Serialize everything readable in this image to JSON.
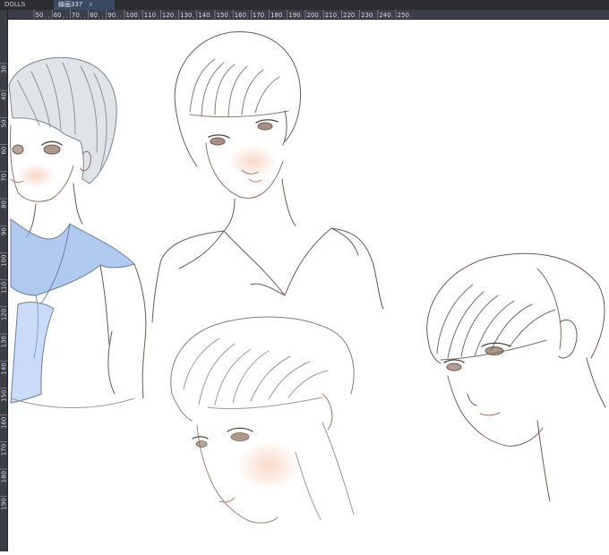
{
  "tabs": [
    {
      "label": "DOLLS",
      "active": false
    },
    {
      "label": "線画337",
      "active": true
    }
  ],
  "ruler": {
    "horizontal_labels": [
      "50",
      "60",
      "70",
      "80",
      "90",
      "100",
      "110",
      "120",
      "130",
      "140",
      "150",
      "160",
      "170",
      "180",
      "190",
      "200",
      "210",
      "220",
      "230",
      "240",
      "250"
    ],
    "vertical_labels": [
      "30",
      "40",
      "50",
      "60",
      "70",
      "80",
      "90",
      "100",
      "110",
      "120",
      "130",
      "140",
      "150",
      "160",
      "170",
      "180",
      "190"
    ]
  },
  "colors": {
    "ui_dark": "#2b2d31",
    "ruler": "#3b3e44",
    "line_art": "#6b5a55",
    "hair_grey": "#9aa3ad",
    "collar_blue": "#8fb3e8",
    "skin": "#f6d8c8"
  },
  "canvas": {
    "content": "figure-sketches",
    "figures": [
      "figure-boy-blue-sailor",
      "figure-girl-bob-sailor",
      "figure-head-bottom-center",
      "figure-head-right"
    ]
  }
}
